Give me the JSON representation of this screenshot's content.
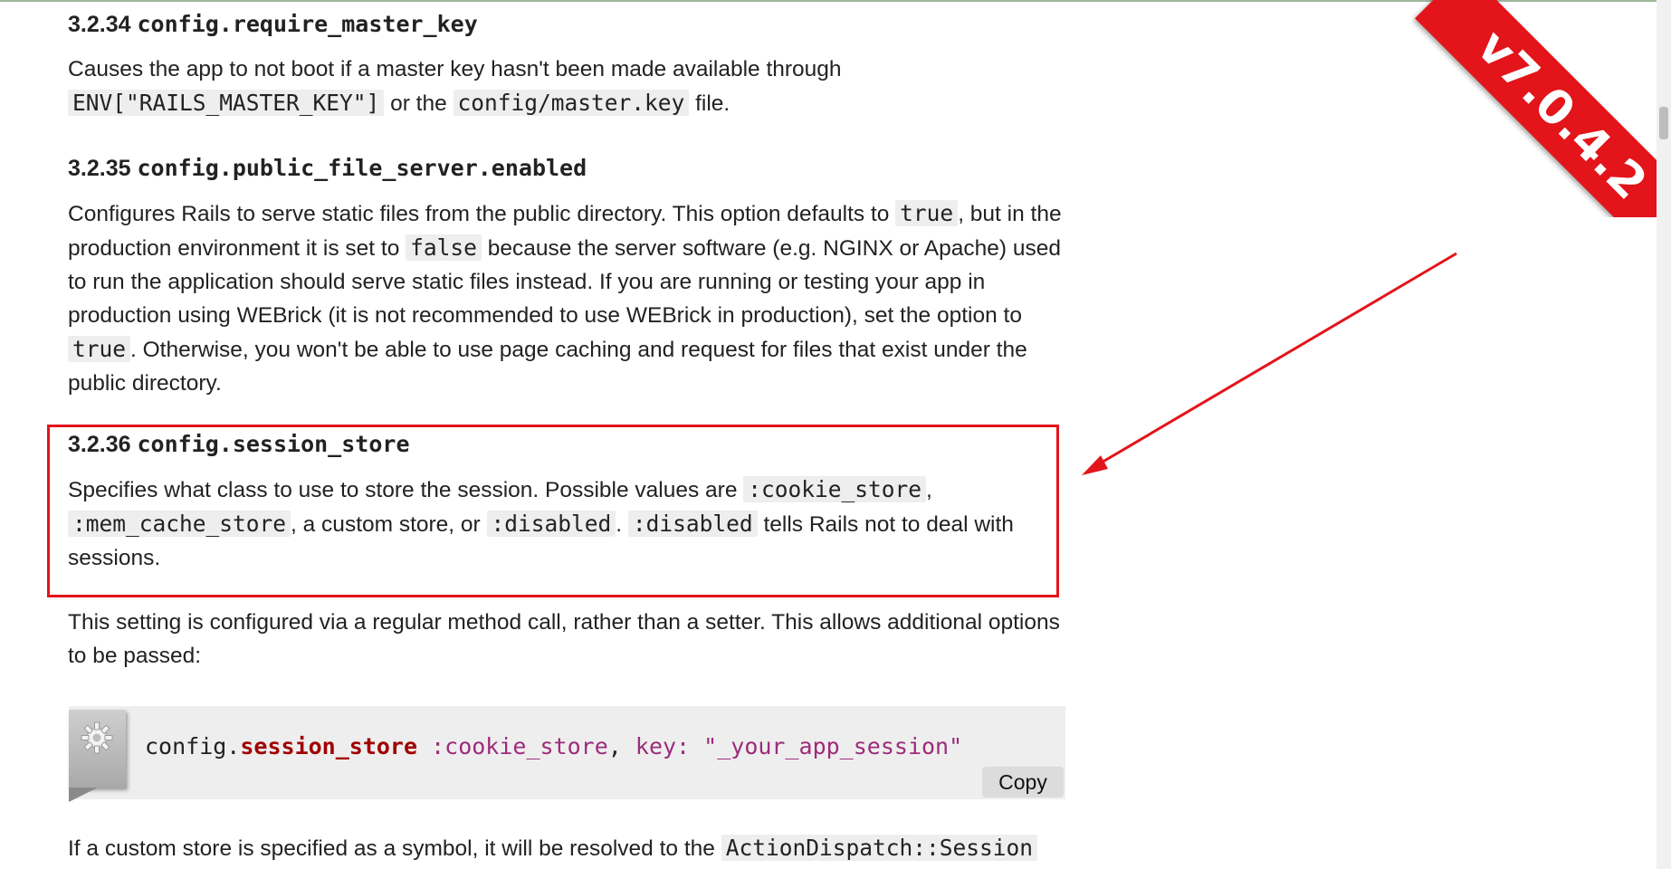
{
  "sections": [
    {
      "number": "3.2.34",
      "key": "config.require_master_key",
      "para": [
        {
          "t": "Causes the app to not boot if a master key hasn't been made available through "
        },
        {
          "c": "ENV[\"RAILS_MASTER_KEY\"]"
        },
        {
          "t": " or the "
        },
        {
          "c": "config/master.key"
        },
        {
          "t": " file."
        }
      ]
    },
    {
      "number": "3.2.35",
      "key": "config.public_file_server.enabled",
      "para": [
        {
          "t": "Configures Rails to serve static files from the public directory. This option defaults to "
        },
        {
          "c": "true"
        },
        {
          "t": ", but in the production environment it is set to "
        },
        {
          "c": "false"
        },
        {
          "t": " because the server software (e.g. NGINX or Apache) used to run the application should serve static files instead. If you are running or testing your app in production using WEBrick (it is not recommended to use WEBrick in production), set the option to "
        },
        {
          "c": "true"
        },
        {
          "t": ". Otherwise, you won't be able to use page caching and request for files that exist under the public directory."
        }
      ]
    },
    {
      "number": "3.2.36",
      "key": "config.session_store",
      "para": [
        {
          "t": "Specifies what class to use to store the session. Possible values are "
        },
        {
          "c": ":cookie_store"
        },
        {
          "t": ", "
        },
        {
          "c": ":mem_cache_store"
        },
        {
          "t": ", a custom store, or "
        },
        {
          "c": ":disabled"
        },
        {
          "t": ". "
        },
        {
          "c": ":disabled"
        },
        {
          "t": " tells Rails not to deal with sessions."
        }
      ]
    }
  ],
  "after_para": "This setting is configured via a regular method call, rather than a setter. This allows additional options to be passed:",
  "code": {
    "obj": "config.",
    "method": "session_store",
    "symbol": ":cookie_store",
    "comma": ",",
    "key": "key:",
    "string": "\"_your_app_session\"",
    "copy_label": "Copy"
  },
  "final_para": [
    {
      "t": "If a custom store is specified as a symbol, it will be resolved to the "
    },
    {
      "c": "ActionDispatch::Session"
    }
  ],
  "ribbon": "v7.0.4.2",
  "colors": {
    "accent": "#e3141a",
    "code_bg": "#eeeeee",
    "method": "#a00000",
    "symbol": "#9c2c7a"
  }
}
